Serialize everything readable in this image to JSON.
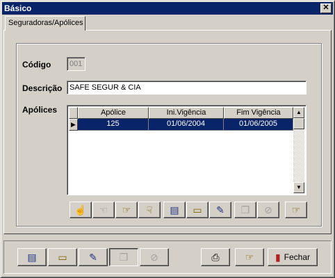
{
  "window": {
    "title": "Básico",
    "close_glyph": "✕"
  },
  "tab": {
    "label": "Seguradoras/Apólices"
  },
  "form": {
    "codigo_label": "Código",
    "codigo_value": "001",
    "descricao_label": "Descrição",
    "descricao_value": "SAFE SEGUR & CIA",
    "apolices_label": "Apólices"
  },
  "grid": {
    "columns": [
      "Apólice",
      "Ini.Vigência",
      "Fim Vigência"
    ],
    "rows": [
      {
        "apolice": "125",
        "ini": "01/06/2004",
        "fim": "01/06/2005",
        "selected": true
      }
    ]
  },
  "grid_toolbar": [
    {
      "name": "hand-up-icon",
      "enabled": false
    },
    {
      "name": "hand-left-icon",
      "enabled": false
    },
    {
      "name": "hand-right-icon",
      "enabled": true
    },
    {
      "name": "hand-down-icon",
      "enabled": true
    },
    {
      "name": "new-record-icon",
      "enabled": true
    },
    {
      "name": "open-folder-icon",
      "enabled": true
    },
    {
      "name": "edit-record-icon",
      "enabled": true
    },
    {
      "name": "copy-record-icon",
      "enabled": false
    },
    {
      "name": "cancel-icon",
      "enabled": false
    },
    {
      "name": "exit-icon",
      "enabled": true
    }
  ],
  "bottom_toolbar": {
    "fechar_label": "Fechar",
    "fechar_underline": "F"
  }
}
